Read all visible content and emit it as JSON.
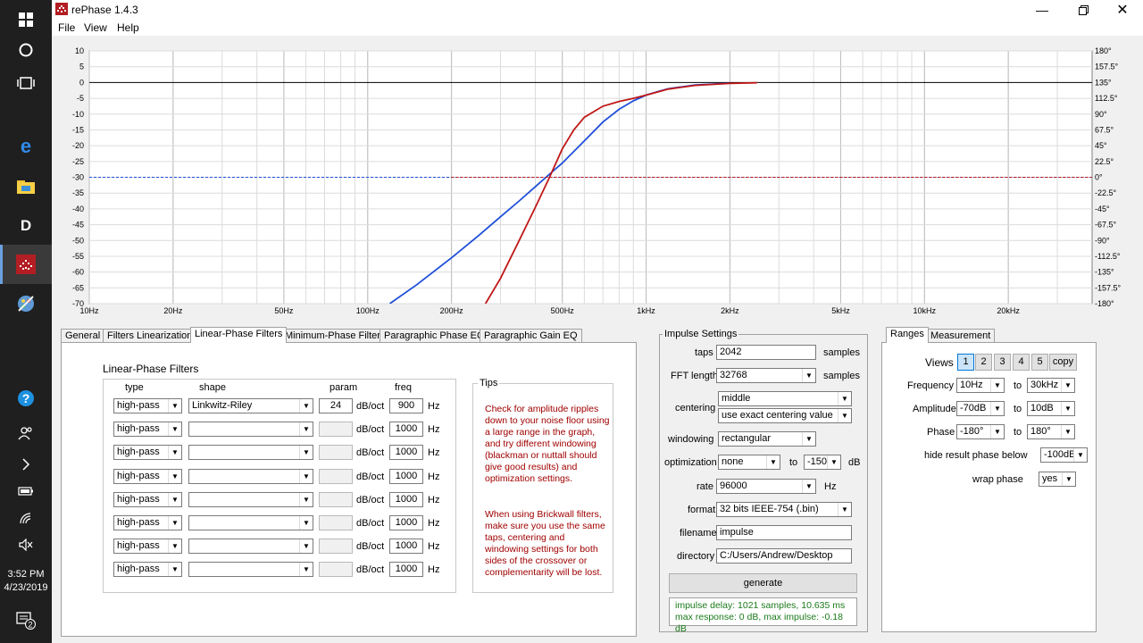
{
  "taskbar": {
    "time": "3:52 PM",
    "date": "4/23/2019",
    "notification_count": "2"
  },
  "window": {
    "title": "rePhase 1.4.3",
    "menu": [
      "File",
      "View",
      "Help"
    ]
  },
  "chart_data": {
    "type": "line",
    "x_scale": "log",
    "xlim": [
      10,
      40000
    ],
    "ylim": [
      -70,
      10
    ],
    "y2lim": [
      -180,
      180
    ],
    "x_ticks": [
      {
        "v": 10,
        "label": "10Hz"
      },
      {
        "v": 20,
        "label": "20Hz"
      },
      {
        "v": 50,
        "label": "50Hz"
      },
      {
        "v": 100,
        "label": "100Hz"
      },
      {
        "v": 200,
        "label": "200Hz"
      },
      {
        "v": 500,
        "label": "500Hz"
      },
      {
        "v": 1000,
        "label": "1kHz"
      },
      {
        "v": 2000,
        "label": "2kHz"
      },
      {
        "v": 5000,
        "label": "5kHz"
      },
      {
        "v": 10000,
        "label": "10kHz"
      },
      {
        "v": 20000,
        "label": "20kHz"
      }
    ],
    "y_ticks": [
      "10",
      "5",
      "0",
      "-5",
      "-10",
      "-15",
      "-20",
      "-25",
      "-30",
      "-35",
      "-40",
      "-45",
      "-50",
      "-55",
      "-60",
      "-65",
      "-70"
    ],
    "y2_ticks": [
      "180°",
      "157.5°",
      "135°",
      "112.5°",
      "90°",
      "67.5°",
      "45°",
      "22.5°",
      "0°",
      "-22.5°",
      "-45°",
      "-67.5°",
      "-90°",
      "-112.5°",
      "-135°",
      "-157.5°",
      "-180°"
    ],
    "grid": true,
    "series": [
      {
        "color": "#1f4fd8",
        "style": "solid",
        "x": [
          120,
          150,
          200,
          250,
          300,
          350,
          400,
          450,
          500,
          600,
          700,
          800,
          900,
          1000,
          1100,
          1200,
          1500,
          2000
        ],
        "y": [
          -70,
          -64,
          -55.5,
          -48.5,
          -42.5,
          -37.5,
          -33,
          -29,
          -25.5,
          -18.5,
          -12.5,
          -8.5,
          -5.8,
          -4,
          -2.9,
          -2,
          -0.8,
          -0.2
        ]
      },
      {
        "color": "#c01818",
        "style": "solid",
        "x": [
          265,
          300,
          350,
          400,
          450,
          500,
          550,
          600,
          700,
          800,
          900,
          1000,
          1100,
          1200,
          1500,
          2000,
          2500
        ],
        "y": [
          -70,
          -62,
          -50,
          -39.5,
          -30,
          -21,
          -15,
          -11,
          -7.5,
          -6,
          -5,
          -4,
          -3,
          -2.1,
          -0.9,
          -0.3,
          -0.1
        ]
      },
      {
        "color": "#1f4fd8",
        "style": "dashed",
        "x": [
          10,
          40000
        ],
        "y": [
          -30,
          -30
        ]
      },
      {
        "color": "#c01818",
        "style": "dashed",
        "x": [
          200,
          40000
        ],
        "y": [
          -30,
          -30
        ]
      }
    ]
  },
  "tabs": [
    "General",
    "Filters Linearization",
    "Linear-Phase Filters",
    "Minimum-Phase Filters",
    "Paragraphic Phase EQ",
    "Paragraphic Gain EQ"
  ],
  "linear_phase": {
    "title": "Linear-Phase Filters",
    "headers": {
      "type": "type",
      "shape": "shape",
      "param": "param",
      "freq": "freq"
    },
    "unit_slope": "dB/oct",
    "unit_hz": "Hz",
    "rows": [
      {
        "type": "high-pass",
        "shape": "Linkwitz-Riley",
        "param": "24",
        "freq": "900"
      },
      {
        "type": "high-pass",
        "shape": "",
        "param": "",
        "freq": "1000"
      },
      {
        "type": "high-pass",
        "shape": "",
        "param": "",
        "freq": "1000"
      },
      {
        "type": "high-pass",
        "shape": "",
        "param": "",
        "freq": "1000"
      },
      {
        "type": "high-pass",
        "shape": "",
        "param": "",
        "freq": "1000"
      },
      {
        "type": "high-pass",
        "shape": "",
        "param": "",
        "freq": "1000"
      },
      {
        "type": "high-pass",
        "shape": "",
        "param": "",
        "freq": "1000"
      },
      {
        "type": "high-pass",
        "shape": "",
        "param": "",
        "freq": "1000"
      }
    ],
    "tips_title": "Tips",
    "tips_1": "Check for amplitude ripples down to your noise floor using a large range in the graph, and try different windowing (blackman or nuttall should give good results) and optimization settings.",
    "tips_2": "When using Brickwall filters, make sure you use the same taps, centering and windowing settings for both sides of the crossover or complementarity will be lost."
  },
  "impulse": {
    "title": "Impulse Settings",
    "taps_label": "taps",
    "taps": "2042",
    "samples": "samples",
    "fft_label": "FFT length",
    "fft": "32768",
    "centering_label": "centering",
    "centering_1": "middle",
    "centering_2": "use exact centering value",
    "windowing_label": "windowing",
    "windowing": "rectangular",
    "optimization_label": "optimization",
    "optimization": "none",
    "to": "to",
    "opt_db": "-150",
    "db": "dB",
    "rate_label": "rate",
    "rate": "96000",
    "hz": "Hz",
    "format_label": "format",
    "format": "32 bits IEEE-754 (.bin)",
    "filename_label": "filename",
    "filename": "impulse",
    "directory_label": "directory",
    "directory": "C:/Users/Andrew/Desktop",
    "generate": "generate",
    "status_1": "impulse delay: 1021 samples, 10.635 ms",
    "status_2": "max response: 0 dB, max impulse: -0.18 dB"
  },
  "ranges": {
    "tabs": [
      "Ranges",
      "Measurement"
    ],
    "views_label": "Views",
    "views": [
      "1",
      "2",
      "3",
      "4",
      "5"
    ],
    "copy": "copy",
    "frequency_label": "Frequency",
    "freq_from": "10Hz",
    "freq_to": "30kHz",
    "amplitude_label": "Amplitude",
    "amp_from": "-70dB",
    "amp_to": "10dB",
    "phase_label": "Phase",
    "phase_from": "-180°",
    "phase_to": "180°",
    "to": "to",
    "hide_label": "hide result phase below",
    "hide": "-100dB",
    "wrap_label": "wrap phase",
    "wrap": "yes"
  }
}
